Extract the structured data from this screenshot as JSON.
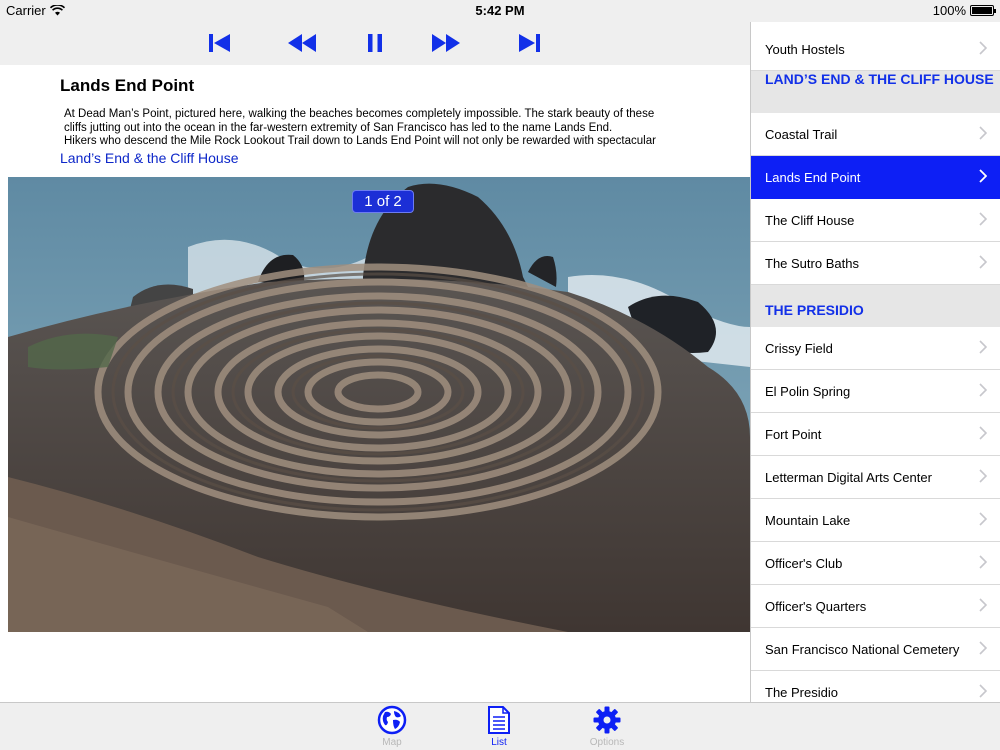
{
  "status": {
    "carrier": "Carrier",
    "time": "5:42 PM",
    "battery": "100%"
  },
  "player": {
    "controls": [
      {
        "name": "skip-back-icon"
      },
      {
        "name": "rewind-icon"
      },
      {
        "name": "pause-icon"
      },
      {
        "name": "fast-forward-icon"
      },
      {
        "name": "skip-forward-icon"
      }
    ]
  },
  "article": {
    "title": "Lands End Point",
    "desc_line1": "At Dead Man’s Point, pictured here, walking the beaches becomes completely impossible. The stark beauty of these",
    "desc_line2": "cliffs jutting out into the ocean in the far-western extremity of San Francisco has led to the name Lands End.",
    "desc_line3": "Hikers who descend the Mile Rock Lookout Trail down to Lands End Point will not only be rewarded with spectacular",
    "section_link": "Land’s End & the Cliff House",
    "page_indicator": "1 of 2"
  },
  "list": {
    "items": [
      {
        "label": "Youth Hostels"
      },
      {
        "header": "LAND’S END & THE CLIFF HOUSE"
      },
      {
        "label": "Coastal Trail"
      },
      {
        "label": "Lands End Point",
        "selected": true
      },
      {
        "label": "The Cliff House"
      },
      {
        "label": "The Sutro Baths"
      },
      {
        "header": "THE PRESIDIO"
      },
      {
        "label": "Crissy Field"
      },
      {
        "label": "El Polin Spring"
      },
      {
        "label": "Fort Point"
      },
      {
        "label": "Letterman Digital Arts Center"
      },
      {
        "label": "Mountain Lake"
      },
      {
        "label": "Officer's Club"
      },
      {
        "label": "Officer's Quarters"
      },
      {
        "label": "San Francisco National Cemetery"
      },
      {
        "label": "The Presidio"
      }
    ]
  },
  "tabs": [
    {
      "label": "Map",
      "icon": "globe-icon"
    },
    {
      "label": "List",
      "icon": "document-icon",
      "active": true
    },
    {
      "label": "Options",
      "icon": "gear-icon"
    }
  ],
  "colors": {
    "accent": "#0d1ff5",
    "header_text": "#1230e8",
    "link": "#0d27c9"
  }
}
